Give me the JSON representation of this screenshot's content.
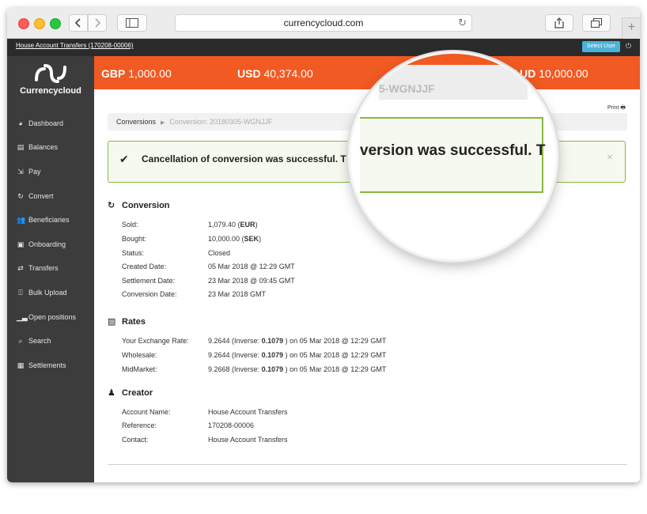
{
  "browser": {
    "url": "currencycloud.com",
    "back_icon": "chevron-left-icon",
    "forward_icon": "chevron-right-icon"
  },
  "topbar": {
    "account_link": "House Account Transfers (170208-00006)",
    "select_user": "Select User",
    "power_icon": "power-icon"
  },
  "brand": {
    "name": "Currencycloud"
  },
  "sidebar": {
    "items": [
      {
        "label": "Dashboard",
        "icon": "dashboard-icon"
      },
      {
        "label": "Balances",
        "icon": "balances-icon"
      },
      {
        "label": "Pay",
        "icon": "pay-icon"
      },
      {
        "label": "Convert",
        "icon": "convert-icon"
      },
      {
        "label": "Beneficiaries",
        "icon": "beneficiaries-icon"
      },
      {
        "label": "Onboarding",
        "icon": "onboarding-icon"
      },
      {
        "label": "Transfers",
        "icon": "transfers-icon"
      },
      {
        "label": "Bulk Upload",
        "icon": "bulk-upload-icon"
      },
      {
        "label": "Open positions",
        "icon": "chart-icon"
      },
      {
        "label": "Search",
        "icon": "search-icon"
      },
      {
        "label": "Settlements",
        "icon": "settlements-icon"
      }
    ]
  },
  "balances": [
    {
      "code": "GBP",
      "amount": "1,000.00"
    },
    {
      "code": "USD",
      "amount": "40,374.00"
    },
    {
      "code": "AUD",
      "amount": "10,000.00"
    }
  ],
  "colors": {
    "accent": "#f15a22",
    "success_border": "#8ab83c",
    "sidebar": "#3c3c3c"
  },
  "content": {
    "print_label": "Print",
    "breadcrumb": {
      "root": "Conversions",
      "current": "Conversion: 20180305-WGNJJF"
    },
    "alert": {
      "message": "Cancellation of conversion was successful. The"
    },
    "conversion": {
      "title": "Conversion",
      "sold_label": "Sold:",
      "sold_amount": "1,079.40",
      "sold_ccy": "EUR",
      "bought_label": "Bought:",
      "bought_amount": "10,000.00",
      "bought_ccy": "SEK",
      "status_label": "Status:",
      "status": "Closed",
      "created_label": "Created Date:",
      "created": "05 Mar 2018 @ 12:29 GMT",
      "settlement_label": "Settlement Date:",
      "settlement": "23 Mar 2018 @ 09:45 GMT",
      "conversion_date_label": "Conversion Date:",
      "conversion_date": "23 Mar 2018 GMT"
    },
    "rates": {
      "title": "Rates",
      "rows": [
        {
          "label": "Your Exchange Rate:",
          "rate": "9.2644",
          "inverse": "0.1079",
          "when": "05 Mar 2018 @ 12:29 GMT"
        },
        {
          "label": "Wholesale:",
          "rate": "9.2644",
          "inverse": "0.1079",
          "when": "05 Mar 2018 @ 12:29 GMT"
        },
        {
          "label": "MidMarket:",
          "rate": "9.2668",
          "inverse": "0.1079",
          "when": "05 Mar 2018 @ 12:29 GMT"
        }
      ],
      "inverse_prefix": "(Inverse: ",
      "on_text": ") on "
    },
    "creator": {
      "title": "Creator",
      "account_label": "Account Name:",
      "account": "House Account Transfers",
      "reference_label": "Reference:",
      "reference": "170208-00006",
      "contact_label": "Contact:",
      "contact": "House Account Transfers"
    }
  },
  "magnifier": {
    "currency_fragment": "EU",
    "reference_fragment": "5-WGNJJF",
    "message_fragment": "version was successful. T"
  }
}
